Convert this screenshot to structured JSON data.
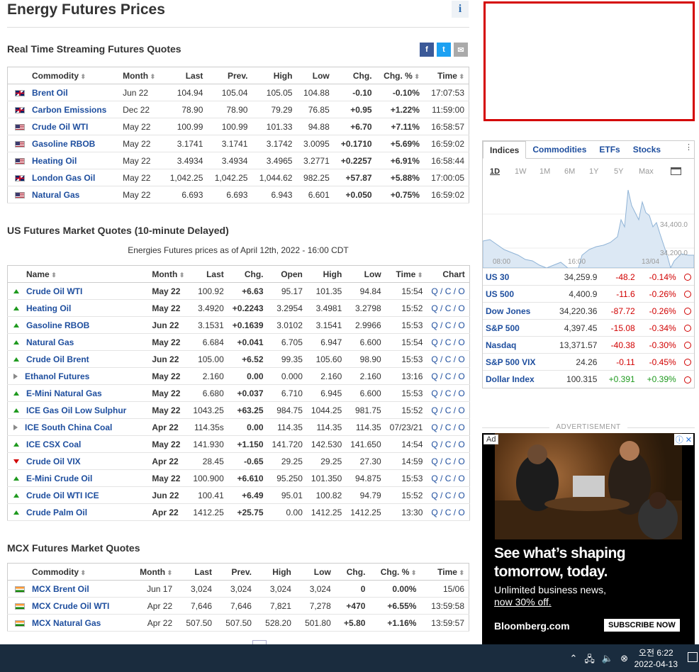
{
  "page": {
    "title": "Energy Futures Prices",
    "info_label": "i"
  },
  "social": {
    "facebook": "f",
    "twitter": "t",
    "email": "✉"
  },
  "realtime": {
    "title": "Real Time Streaming Futures Quotes",
    "headers": [
      "Commodity",
      "Month",
      "Last",
      "Prev.",
      "High",
      "Low",
      "Chg.",
      "Chg. %",
      "Time"
    ],
    "rows": [
      {
        "flag": "uk",
        "name": "Brent Oil",
        "month": "Jun 22",
        "last": "104.94",
        "prev": "105.04",
        "high": "105.05",
        "low": "104.88",
        "chg": "-0.10",
        "chgpct": "-0.10%",
        "time": "17:07:53",
        "dir": "neg"
      },
      {
        "flag": "uk",
        "name": "Carbon Emissions",
        "month": "Dec 22",
        "last": "78.90",
        "prev": "78.90",
        "high": "79.29",
        "low": "76.85",
        "chg": "+0.95",
        "chgpct": "+1.22%",
        "time": "11:59:00",
        "dir": "pos"
      },
      {
        "flag": "us",
        "name": "Crude Oil WTI",
        "month": "May 22",
        "last": "100.99",
        "prev": "100.99",
        "high": "101.33",
        "low": "94.88",
        "chg": "+6.70",
        "chgpct": "+7.11%",
        "time": "16:58:57",
        "dir": "pos"
      },
      {
        "flag": "us",
        "name": "Gasoline RBOB",
        "month": "May 22",
        "last": "3.1741",
        "prev": "3.1741",
        "high": "3.1742",
        "low": "3.0095",
        "chg": "+0.1710",
        "chgpct": "+5.69%",
        "time": "16:59:02",
        "dir": "pos"
      },
      {
        "flag": "us",
        "name": "Heating Oil",
        "month": "May 22",
        "last": "3.4934",
        "prev": "3.4934",
        "high": "3.4965",
        "low": "3.2771",
        "chg": "+0.2257",
        "chgpct": "+6.91%",
        "time": "16:58:44",
        "dir": "pos"
      },
      {
        "flag": "uk",
        "name": "London Gas Oil",
        "month": "May 22",
        "last": "1,042.25",
        "prev": "1,042.25",
        "high": "1,044.62",
        "low": "982.25",
        "chg": "+57.87",
        "chgpct": "+5.88%",
        "time": "17:00:05",
        "dir": "pos"
      },
      {
        "flag": "us",
        "name": "Natural Gas",
        "month": "May 22",
        "last": "6.693",
        "prev": "6.693",
        "high": "6.943",
        "low": "6.601",
        "chg": "+0.050",
        "chgpct": "+0.75%",
        "time": "16:59:02",
        "dir": "pos"
      }
    ]
  },
  "us": {
    "title": "US Futures Market Quotes (10-minute Delayed)",
    "subtitle": "Energies Futures prices as of April 12th, 2022 - 16:00 CDT",
    "headers": [
      "Name",
      "Month",
      "Last",
      "Chg.",
      "Open",
      "High",
      "Low",
      "Time",
      "Chart"
    ],
    "rows": [
      {
        "arrow": "up",
        "name": "Crude Oil WTI",
        "month": "May 22",
        "last": "100.92",
        "chg": "+6.63",
        "open": "95.17",
        "high": "101.35",
        "low": "94.84",
        "time": "15:54",
        "dir": "pos"
      },
      {
        "arrow": "up",
        "name": "Heating Oil",
        "month": "May 22",
        "last": "3.4920",
        "chg": "+0.2243",
        "open": "3.2954",
        "high": "3.4981",
        "low": "3.2798",
        "time": "15:52",
        "dir": "pos"
      },
      {
        "arrow": "up",
        "name": "Gasoline RBOB",
        "month": "Jun 22",
        "last": "3.1531",
        "chg": "+0.1639",
        "open": "3.0102",
        "high": "3.1541",
        "low": "2.9966",
        "time": "15:53",
        "dir": "pos"
      },
      {
        "arrow": "up",
        "name": "Natural Gas",
        "month": "May 22",
        "last": "6.684",
        "chg": "+0.041",
        "open": "6.705",
        "high": "6.947",
        "low": "6.600",
        "time": "15:54",
        "dir": "pos"
      },
      {
        "arrow": "up",
        "name": "Crude Oil Brent",
        "month": "Jun 22",
        "last": "105.00",
        "chg": "+6.52",
        "open": "99.35",
        "high": "105.60",
        "low": "98.90",
        "time": "15:53",
        "dir": "pos"
      },
      {
        "arrow": "rt",
        "name": "Ethanol Futures",
        "month": "May 22",
        "last": "2.160",
        "chg": "0.00",
        "open": "0.000",
        "high": "2.160",
        "low": "2.160",
        "time": "13:16",
        "dir": "zero"
      },
      {
        "arrow": "up",
        "name": "E-Mini Natural Gas",
        "month": "May 22",
        "last": "6.680",
        "chg": "+0.037",
        "open": "6.710",
        "high": "6.945",
        "low": "6.600",
        "time": "15:53",
        "dir": "pos"
      },
      {
        "arrow": "up",
        "name": "ICE Gas Oil Low Sulphur",
        "month": "May 22",
        "last": "1043.25",
        "chg": "+63.25",
        "open": "984.75",
        "high": "1044.25",
        "low": "981.75",
        "time": "15:52",
        "dir": "pos"
      },
      {
        "arrow": "rt",
        "name": "ICE South China Coal",
        "month": "Apr 22",
        "last": "114.35s",
        "chg": "0.00",
        "open": "114.35",
        "high": "114.35",
        "low": "114.35",
        "time": "07/23/21",
        "dir": "zero"
      },
      {
        "arrow": "up",
        "name": "ICE CSX Coal",
        "month": "May 22",
        "last": "141.930",
        "chg": "+1.150",
        "open": "141.720",
        "high": "142.530",
        "low": "141.650",
        "time": "14:54",
        "dir": "pos"
      },
      {
        "arrow": "dn",
        "name": "Crude Oil VIX",
        "month": "Apr 22",
        "last": "28.45",
        "chg": "-0.65",
        "open": "29.25",
        "high": "29.25",
        "low": "27.30",
        "time": "14:59",
        "dir": "neg"
      },
      {
        "arrow": "up",
        "name": "E-Mini Crude Oil",
        "month": "May 22",
        "last": "100.900",
        "chg": "+6.610",
        "open": "95.250",
        "high": "101.350",
        "low": "94.875",
        "time": "15:53",
        "dir": "pos"
      },
      {
        "arrow": "up",
        "name": "Crude Oil WTI ICE",
        "month": "Jun 22",
        "last": "100.41",
        "chg": "+6.49",
        "open": "95.01",
        "high": "100.82",
        "low": "94.79",
        "time": "15:52",
        "dir": "pos"
      },
      {
        "arrow": "up",
        "name": "Crude Palm Oil",
        "month": "Apr 22",
        "last": "1412.25",
        "chg": "+25.75",
        "open": "0.00",
        "high": "1412.25",
        "low": "1412.25",
        "time": "13:30",
        "dir": "pos"
      }
    ],
    "chart_links": "Q / C / O"
  },
  "mcx": {
    "title": "MCX Futures Market Quotes",
    "headers": [
      "Commodity",
      "Month",
      "Last",
      "Prev.",
      "High",
      "Low",
      "Chg.",
      "Chg. %",
      "Time"
    ],
    "rows": [
      {
        "name": "MCX Brent Oil",
        "month": "Jun 17",
        "last": "3,024",
        "prev": "3,024",
        "high": "3,024",
        "low": "3,024",
        "chg": "0",
        "chgpct": "0.00%",
        "time": "15/06",
        "dir": "zero"
      },
      {
        "name": "MCX Crude Oil WTI",
        "month": "Apr 22",
        "last": "7,646",
        "prev": "7,646",
        "high": "7,821",
        "low": "7,278",
        "chg": "+470",
        "chgpct": "+6.55%",
        "time": "13:59:58",
        "dir": "pos"
      },
      {
        "name": "MCX Natural Gas",
        "month": "Apr 22",
        "last": "507.50",
        "prev": "507.50",
        "high": "528.20",
        "low": "501.80",
        "chg": "+5.80",
        "chgpct": "+1.16%",
        "time": "13:59:57",
        "dir": "pos"
      }
    ]
  },
  "widget": {
    "tabs": [
      "Indices",
      "Commodities",
      "ETFs",
      "Stocks"
    ],
    "ranges": [
      "1D",
      "1W",
      "1M",
      "6M",
      "1Y",
      "5Y",
      "Max"
    ],
    "chart_labels": {
      "y_high": "34,400.0",
      "y_low": "34,200.0",
      "x1": "08:00",
      "x2": "16:00",
      "x3": "13/04"
    },
    "indices": [
      {
        "name": "US 30",
        "last": "34,259.9",
        "chg": "-48.2",
        "pct": "-0.14%",
        "dir": "neg"
      },
      {
        "name": "US 500",
        "last": "4,400.9",
        "chg": "-11.6",
        "pct": "-0.26%",
        "dir": "neg"
      },
      {
        "name": "Dow Jones",
        "last": "34,220.36",
        "chg": "-87.72",
        "pct": "-0.26%",
        "dir": "neg"
      },
      {
        "name": "S&P 500",
        "last": "4,397.45",
        "chg": "-15.08",
        "pct": "-0.34%",
        "dir": "neg"
      },
      {
        "name": "Nasdaq",
        "last": "13,371.57",
        "chg": "-40.38",
        "pct": "-0.30%",
        "dir": "neg"
      },
      {
        "name": "S&P 500 VIX",
        "last": "24.26",
        "chg": "-0.11",
        "pct": "-0.45%",
        "dir": "neg"
      },
      {
        "name": "Dollar Index",
        "last": "100.315",
        "chg": "+0.391",
        "pct": "+0.39%",
        "dir": "pos"
      }
    ]
  },
  "ad": {
    "label": "ADVERTISEMENT",
    "tag": "Ad",
    "headline1": "See what’s shaping",
    "headline2": "tomorrow, today.",
    "sub1": "Unlimited business news,",
    "sub2": "now 30% off.",
    "logo": "Bloomberg.com",
    "cta": "SUBSCRIBE NOW"
  },
  "taskbar": {
    "time": "오전 6:22",
    "date": "2022-04-13"
  }
}
